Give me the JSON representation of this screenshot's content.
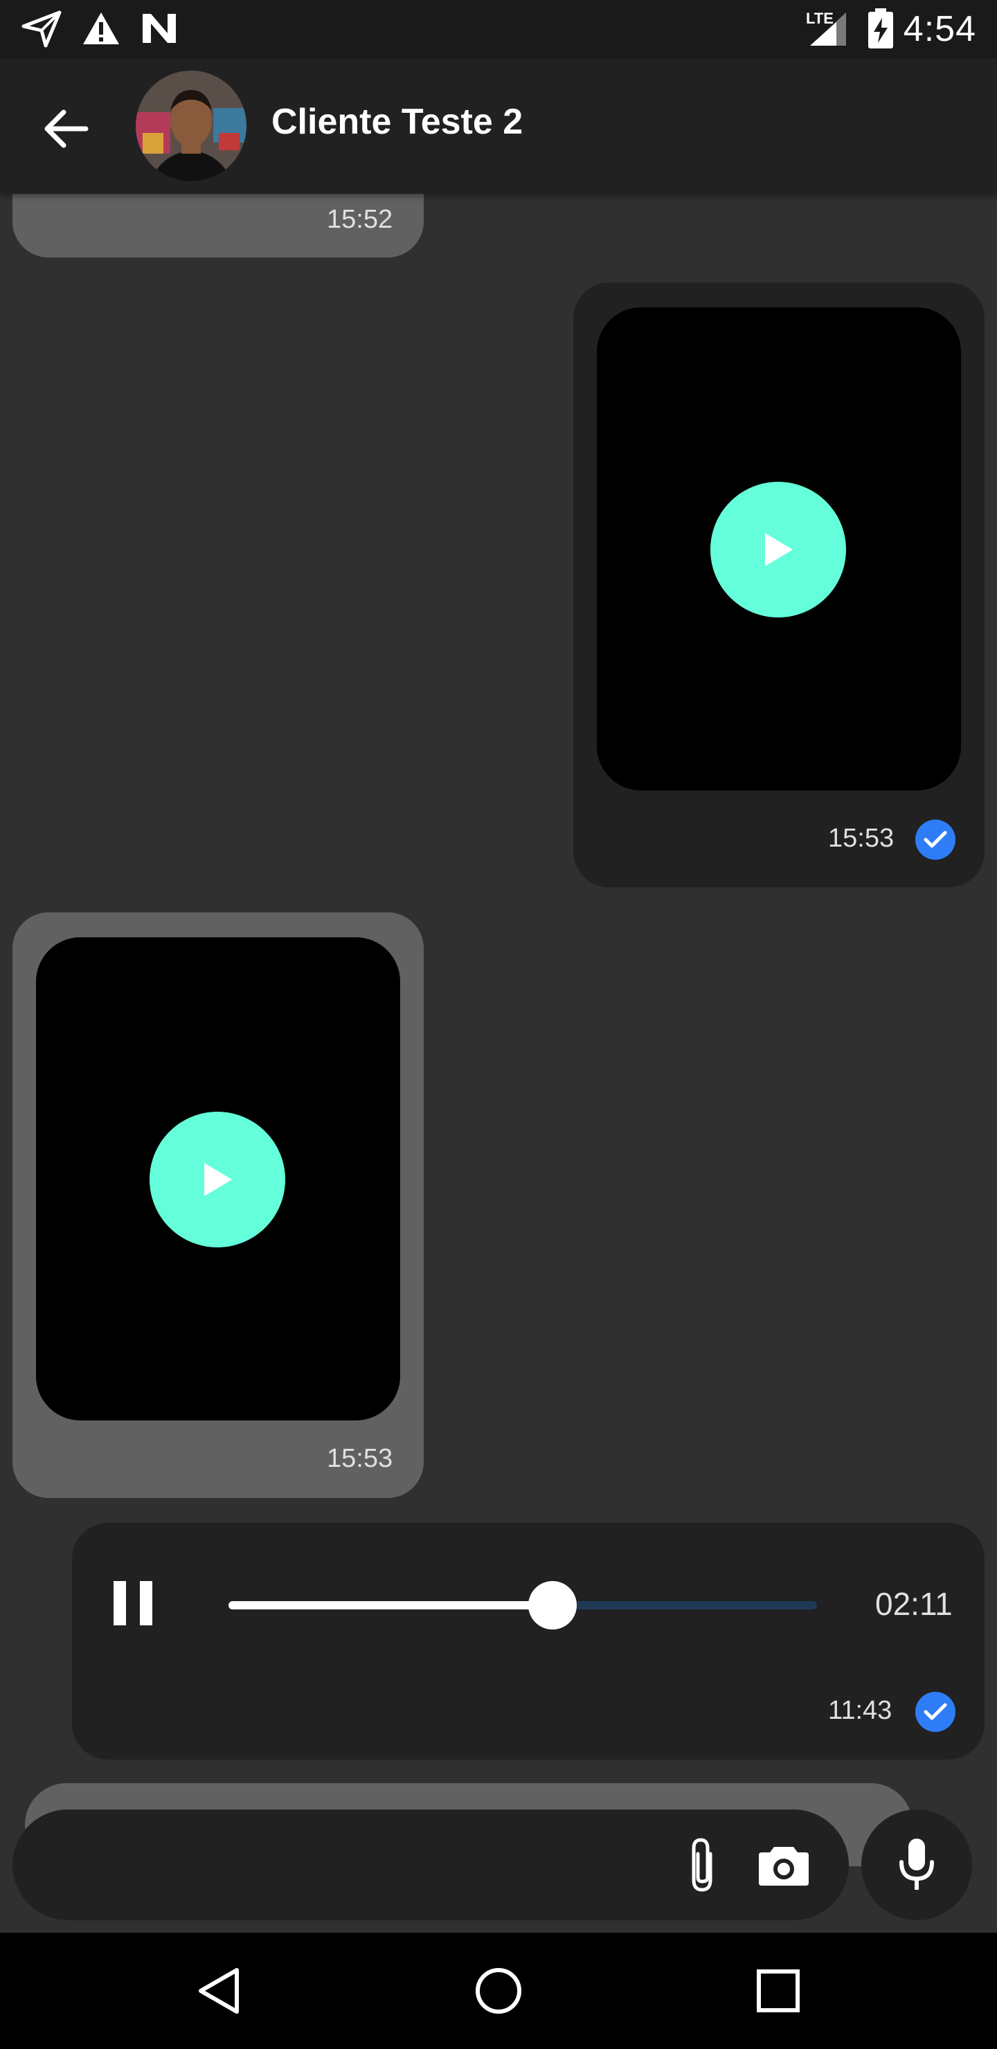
{
  "status_bar": {
    "time": "4:54",
    "network": "LTE",
    "icons": [
      "navigation-icon",
      "warning-icon",
      "n-badge-icon",
      "signal-icon",
      "battery-charging-icon"
    ]
  },
  "header": {
    "contact_name": "Cliente Teste 2",
    "back_icon": "arrow-back-icon",
    "avatar": "contact-avatar"
  },
  "messages": [
    {
      "direction": "incoming",
      "type": "text",
      "time": "15:52"
    },
    {
      "direction": "outgoing",
      "type": "video",
      "time": "15:53",
      "status_icon": "check-circle-icon"
    },
    {
      "direction": "incoming",
      "type": "video",
      "time": "15:53"
    },
    {
      "direction": "outgoing",
      "type": "audio",
      "duration": "02:11",
      "progress": 0.55,
      "time": "11:43",
      "status_icon": "check-circle-icon"
    }
  ],
  "composer": {
    "placeholder": "",
    "attach_icon": "paperclip-icon",
    "camera_icon": "camera-icon",
    "mic_icon": "microphone-icon"
  },
  "nav_bar": {
    "icons": [
      "back-triangle-icon",
      "home-circle-icon",
      "recents-square-icon"
    ]
  },
  "colors": {
    "background": "#303030",
    "app_bar": "#212121",
    "incoming_bubble": "#616161",
    "outgoing_bubble": "#212121",
    "play_button": "#64ffda",
    "read_check": "#2f7df6",
    "audio_track": "#1e3a55"
  }
}
